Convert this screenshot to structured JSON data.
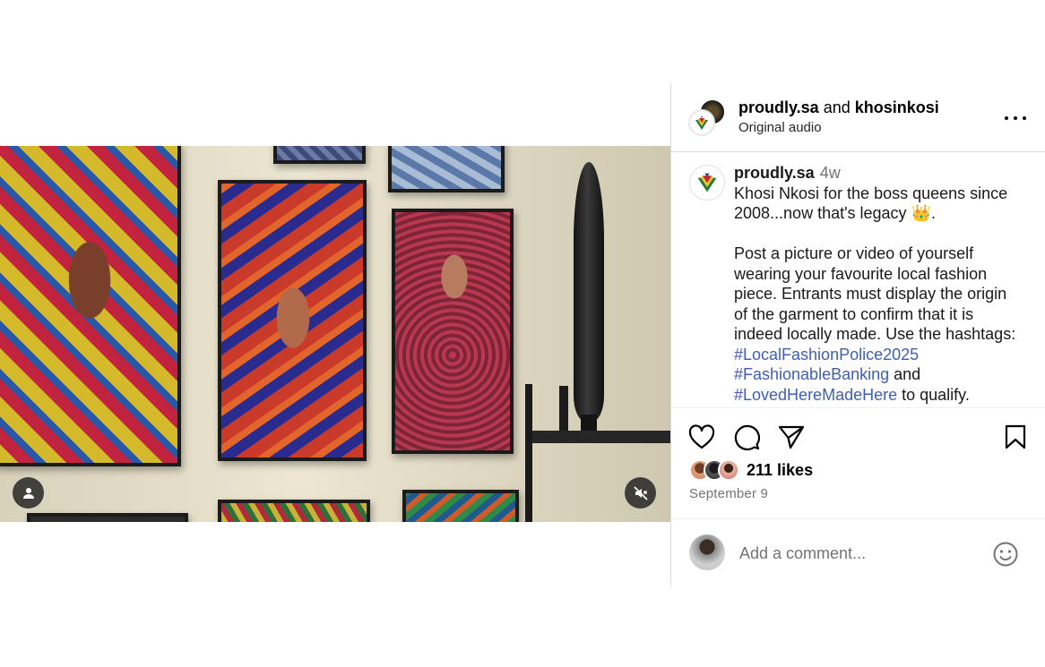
{
  "media": {
    "tag_icon": "person-icon",
    "mute_icon": "speaker-muted-icon"
  },
  "header": {
    "user1": "proudly.sa",
    "joiner": "and",
    "user2": "khosinkosi",
    "audio": "Original audio",
    "more_icon": "more-options-icon"
  },
  "caption": {
    "username": "proudly.sa",
    "time": "4w",
    "lines_part1": [
      "Khosi Nkosi for the boss queens since",
      "2008...now that's legacy 👑."
    ],
    "lines_part2": [
      "Post a picture or video of yourself",
      "wearing your favourite local fashion",
      "piece. Entrants must display the origin",
      "of the garment to confirm that it is",
      "indeed locally made. Use the hashtags:"
    ],
    "hashtag1": "#LocalFashionPolice2025",
    "hashtag2": "#FashionableBanking",
    "and_text": "and",
    "hashtag3": "#LovedHereMadeHere",
    "qualify_text": "to qualify."
  },
  "actions": {
    "like_icon": "heart-icon",
    "comment_icon": "comment-icon",
    "share_icon": "share-icon",
    "save_icon": "bookmark-icon"
  },
  "likes": {
    "text": "211 likes"
  },
  "date": "September 9",
  "comment": {
    "placeholder": "Add a comment...",
    "emoji_icon": "emoji-icon"
  },
  "colors": {
    "hashtag": "#3f5eb5",
    "border": "#dbdbdb",
    "muted": "#737373"
  }
}
